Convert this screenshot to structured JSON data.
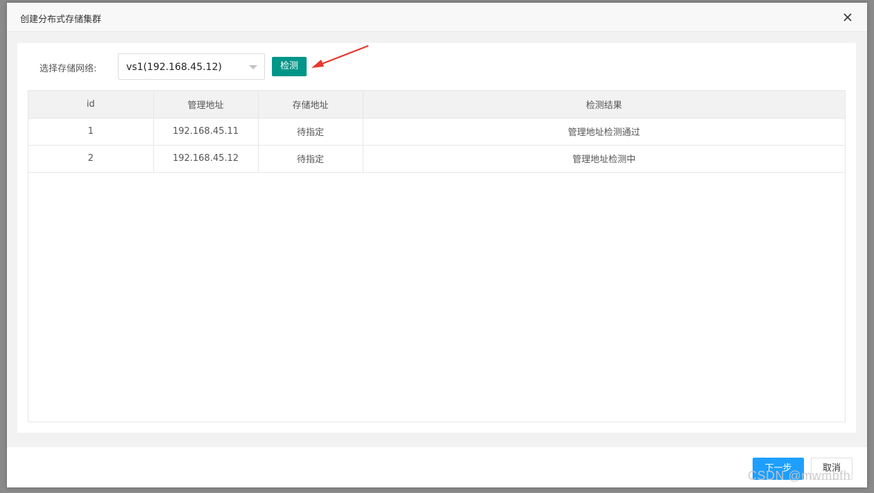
{
  "dialog": {
    "title": "创建分布式存储集群",
    "close_icon": "close-icon"
  },
  "form": {
    "network_label": "选择存储网络:",
    "network_selected": "vs1(192.168.45.12)",
    "detect_label": "检测"
  },
  "table": {
    "columns": [
      "id",
      "管理地址",
      "存储地址",
      "检测结果"
    ],
    "rows": [
      {
        "id": "1",
        "mgmt": "192.168.45.11",
        "storage": "待指定",
        "result": "管理地址检测通过"
      },
      {
        "id": "2",
        "mgmt": "192.168.45.12",
        "storage": "待指定",
        "result": "管理地址检测中"
      }
    ]
  },
  "footer": {
    "next_label": "下一步",
    "cancel_label": "取消"
  },
  "watermark": "CSDN @mwmbfh",
  "colors": {
    "detect_button": "#009688",
    "next_button": "#1e9fff",
    "annotation_arrow": "#e8372c"
  }
}
